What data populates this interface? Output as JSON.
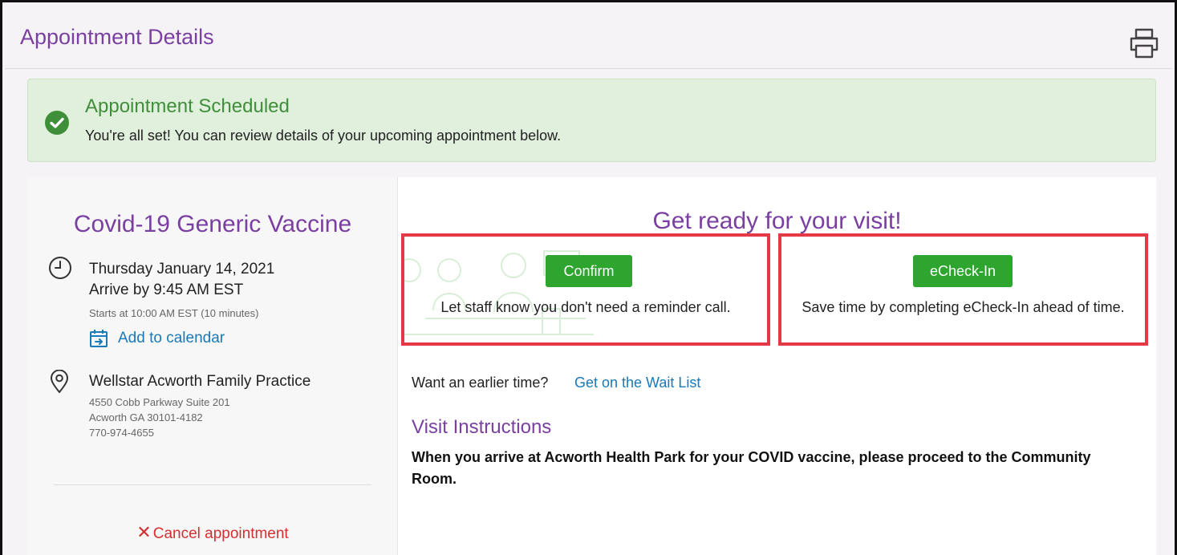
{
  "header": {
    "title": "Appointment Details",
    "print_icon": "printer-icon"
  },
  "banner": {
    "title": "Appointment Scheduled",
    "message": "You're all set! You can review details of your upcoming appointment below.",
    "icon": "check-circle-icon",
    "color": "#3f8f3a"
  },
  "appointment": {
    "title": "Covid-19 Generic Vaccine",
    "date": "Thursday January 14, 2021",
    "arrive": "Arrive by 9:45 AM EST",
    "starts": "Starts at 10:00 AM EST (10 minutes)",
    "add_calendar": "Add to calendar",
    "location": {
      "name": "Wellstar Acworth Family Practice",
      "street": "4550 Cobb Parkway Suite 201",
      "city": "Acworth GA 30101-4182",
      "phone": "770-974-4655"
    },
    "cancel": "Cancel appointment"
  },
  "ready": {
    "title": "Get ready for your visit!",
    "confirm": {
      "button": "Confirm",
      "text": "Let staff know you don't need a reminder call."
    },
    "echeck": {
      "button": "eCheck-In",
      "text": "Save time by completing eCheck-In ahead of time."
    }
  },
  "wait_list": {
    "question": "Want an earlier time?",
    "link": "Get on the Wait List"
  },
  "instructions": {
    "title": "Visit Instructions",
    "text": "When you arrive at Acworth Health Park for your COVID vaccine, please proceed to the Community Room."
  },
  "colors": {
    "accent": "#7a3fa0",
    "link": "#1a79b8",
    "button": "#2ea52e",
    "highlight": "#e53945",
    "cancel": "#d32f2f"
  }
}
